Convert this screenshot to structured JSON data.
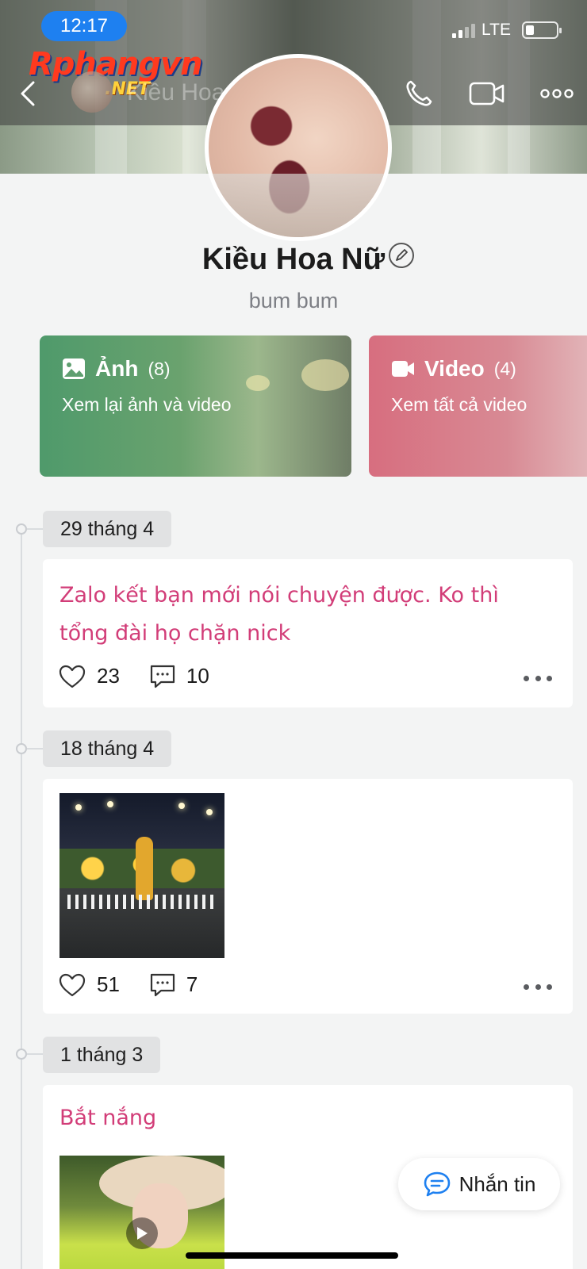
{
  "status_bar": {
    "time": "12:17",
    "network": "LTE"
  },
  "watermark": {
    "brand": "Rphangvn",
    "suffix": ".NET"
  },
  "nav": {
    "title": "Kiều Hoa Nữ"
  },
  "profile": {
    "name": "Kiều Hoa Nữ",
    "bio": "bum bum"
  },
  "albums": [
    {
      "title": "Ảnh",
      "count": "(8)",
      "subtitle": "Xem lại ảnh và video",
      "icon": "image-icon"
    },
    {
      "title": "Video",
      "count": "(4)",
      "subtitle": "Xem tất cả video",
      "icon": "video-camera-icon"
    }
  ],
  "posts": [
    {
      "date": "29 tháng 4",
      "text": "Zalo kết bạn mới nói chuyện được. Ko thì tổng đài họ chặn nick",
      "likes": "23",
      "comments": "10"
    },
    {
      "date": "18 tháng 4",
      "likes": "51",
      "comments": "7",
      "media": "photo"
    },
    {
      "date": "1 tháng 3",
      "text": "Bắt nắng",
      "media": "video"
    }
  ],
  "fab": {
    "label": "Nhắn tin"
  },
  "colors": {
    "accent": "#1e80f0",
    "post_text": "#d23d78",
    "photo_card": "#4f9a6b",
    "video_card": "#d76e7f"
  }
}
